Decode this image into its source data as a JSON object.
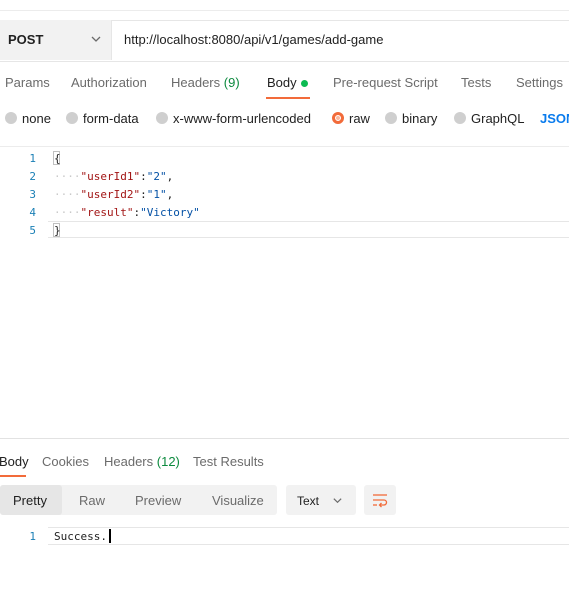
{
  "request": {
    "method": "POST",
    "url": "http://localhost:8080/api/v1/games/add-game"
  },
  "request_tabs": {
    "params": "Params",
    "authorization": "Authorization",
    "headers": "Headers",
    "headers_count": "(9)",
    "body": "Body",
    "prerequest": "Pre-request Script",
    "tests": "Tests",
    "settings": "Settings"
  },
  "body_types": {
    "none": "none",
    "form_data": "form-data",
    "urlencoded": "x-www-form-urlencoded",
    "raw": "raw",
    "binary": "binary",
    "graphql": "GraphQL",
    "json": "JSON",
    "selected": "raw"
  },
  "editor": {
    "line_numbers": [
      "1",
      "2",
      "3",
      "4",
      "5"
    ],
    "open_brace": "{",
    "close_brace": "}",
    "indent": "····",
    "lines": [
      {
        "key": "\"userId1\"",
        "colon": ":",
        "value": "\"2\"",
        "trail": ","
      },
      {
        "key": "\"userId2\"",
        "colon": ":",
        "value": "\"1\"",
        "trail": ","
      },
      {
        "key": "\"result\"",
        "colon": ":",
        "value": "\"Victory\"",
        "trail": ""
      }
    ]
  },
  "response_tabs": {
    "body": "Body",
    "cookies": "Cookies",
    "headers": "Headers",
    "headers_count": "(12)",
    "test_results": "Test Results"
  },
  "response_view": {
    "modes": [
      "Pretty",
      "Raw",
      "Preview",
      "Visualize"
    ],
    "selected_mode": "Pretty",
    "format": "Text"
  },
  "response_body": {
    "line_number": "1",
    "text": "Success."
  },
  "colors": {
    "accent": "#f26b3a",
    "success_dot": "#0cbb52",
    "link": "#097bed"
  }
}
